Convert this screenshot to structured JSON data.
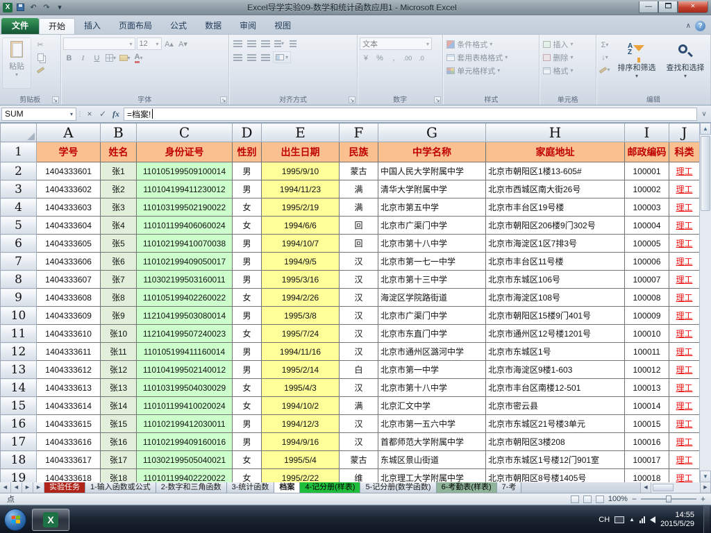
{
  "titlebar": {
    "title": "Excel导学实验09-数学和统计函数应用1 - Microsoft Excel"
  },
  "ribbon": {
    "file_tab": "文件",
    "tabs": [
      "开始",
      "插入",
      "页面布局",
      "公式",
      "数据",
      "审阅",
      "视图"
    ],
    "active_tab": "开始",
    "group_labels": [
      "剪贴板",
      "字体",
      "对齐方式",
      "数字",
      "样式",
      "单元格",
      "编辑"
    ],
    "clipboard": {
      "paste_label": "粘贴"
    },
    "font": {
      "name": "",
      "size": "12"
    },
    "number": {
      "format": "文本"
    },
    "styles_items": [
      "条件格式",
      "套用表格格式",
      "单元格样式"
    ],
    "cells_items": [
      "插入",
      "删除",
      "格式"
    ],
    "editing_items": [
      "排序和筛选",
      "查找和选择"
    ]
  },
  "formula_bar": {
    "name_box": "SUM",
    "formula": "=档案!"
  },
  "sheet": {
    "col_letters": [
      "A",
      "B",
      "C",
      "D",
      "E",
      "F",
      "G",
      "H",
      "I",
      "J"
    ],
    "header_row": [
      "学号",
      "姓名",
      "身份证号",
      "性别",
      "出生日期",
      "民族",
      "中学名称",
      "家庭地址",
      "邮政编码",
      "科类"
    ],
    "rows": [
      [
        "1404333601",
        "张1",
        "110105199509100014",
        "男",
        "1995/9/10",
        "蒙古",
        "中国人民大学附属中学",
        "北京市朝阳区1楼13-605#",
        "100001",
        "理工"
      ],
      [
        "1404333602",
        "张2",
        "110104199411230012",
        "男",
        "1994/11/23",
        "满",
        "清华大学附属中学",
        "北京市西城区南大街26号",
        "100002",
        "理工"
      ],
      [
        "1404333603",
        "张3",
        "110103199502190022",
        "女",
        "1995/2/19",
        "满",
        "北京市第五中学",
        "北京市丰台区19号楼",
        "100003",
        "理工"
      ],
      [
        "1404333604",
        "张4",
        "110101199406060024",
        "女",
        "1994/6/6",
        "回",
        "北京市广渠门中学",
        "北京市朝阳区206楼9门302号",
        "100004",
        "理工"
      ],
      [
        "1404333605",
        "张5",
        "110102199410070038",
        "男",
        "1994/10/7",
        "回",
        "北京市第十八中学",
        "北京市海淀区1区7排3号",
        "100005",
        "理工"
      ],
      [
        "1404333606",
        "张6",
        "110102199409050017",
        "男",
        "1994/9/5",
        "汉",
        "北京市第一七一中学",
        "北京市丰台区11号楼",
        "100006",
        "理工"
      ],
      [
        "1404333607",
        "张7",
        "110302199503160011",
        "男",
        "1995/3/16",
        "汉",
        "北京市第十三中学",
        "北京市东城区106号",
        "100007",
        "理工"
      ],
      [
        "1404333608",
        "张8",
        "110105199402260022",
        "女",
        "1994/2/26",
        "汉",
        "海淀区学院路街道",
        "北京市海淀区108号",
        "100008",
        "理工"
      ],
      [
        "1404333609",
        "张9",
        "112104199503080014",
        "男",
        "1995/3/8",
        "汉",
        "北京市广渠门中学",
        "北京市朝阳区15楼9门401号",
        "100009",
        "理工"
      ],
      [
        "1404333610",
        "张10",
        "112104199507240023",
        "女",
        "1995/7/24",
        "汉",
        "北京市东直门中学",
        "北京市通州区12号楼1201号",
        "100010",
        "理工"
      ],
      [
        "1404333611",
        "张11",
        "110105199411160014",
        "男",
        "1994/11/16",
        "汉",
        "北京市通州区潞河中学",
        "北京市东城区1号",
        "100011",
        "理工"
      ],
      [
        "1404333612",
        "张12",
        "110104199502140012",
        "男",
        "1995/2/14",
        "白",
        "北京市第一中学",
        "北京市海淀区9楼1-603",
        "100012",
        "理工"
      ],
      [
        "1404333613",
        "张13",
        "110103199504030029",
        "女",
        "1995/4/3",
        "汉",
        "北京市第十八中学",
        "北京市丰台区南楼12-501",
        "100013",
        "理工"
      ],
      [
        "1404333614",
        "张14",
        "110101199410020024",
        "女",
        "1994/10/2",
        "满",
        "北京汇文中学",
        "北京市密云县",
        "100014",
        "理工"
      ],
      [
        "1404333615",
        "张15",
        "110102199412030011",
        "男",
        "1994/12/3",
        "汉",
        "北京市第一五六中学",
        "北京市东城区21号楼3单元",
        "100015",
        "理工"
      ],
      [
        "1404333616",
        "张16",
        "110102199409160016",
        "男",
        "1994/9/16",
        "汉",
        "首都师范大学附属中学",
        "北京市朝阳区3楼208",
        "100016",
        "理工"
      ],
      [
        "1404333617",
        "张17",
        "110302199505040021",
        "女",
        "1995/5/4",
        "蒙古",
        "东城区景山街道",
        "北京市东城区1号楼12门901室",
        "100017",
        "理工"
      ],
      [
        "1404333618",
        "张18",
        "110101199402220022",
        "女",
        "1995/2/22",
        "维",
        "北京理工大学附属中学",
        "北京市朝阳区8号楼1405号",
        "100018",
        "理工"
      ]
    ]
  },
  "sheet_tabs": {
    "tabs": [
      {
        "label": "实验任务",
        "bg": "#AF2318",
        "fg": "#FFFFFF"
      },
      {
        "label": "1-输入函数或公式"
      },
      {
        "label": "2-数字和三角函数"
      },
      {
        "label": "3-统计函数"
      },
      {
        "label": "档案",
        "active": true
      },
      {
        "label": "4-记分册(样表)",
        "bg": "#1FBF3C",
        "fg": "#000000"
      },
      {
        "label": "5-记分册(数学函数)"
      },
      {
        "label": "6-考勤表(样表)",
        "bg": "#8FB49A",
        "fg": "#000000"
      },
      {
        "label": "7-考"
      }
    ]
  },
  "status_bar": {
    "mode": "点",
    "zoom": "100%"
  },
  "taskbar": {
    "lang": "CH",
    "time": "14:55",
    "date": "2015/5/29"
  },
  "icons": {
    "undo": "↶",
    "redo": "↷",
    "dropdown": "▼",
    "dropdown_small": "▾",
    "cut": "✂",
    "sum": "Σ",
    "fill_down": "↓",
    "cancel": "×",
    "confirm": "✓",
    "fx": "fx",
    "bold": "B",
    "italic": "I",
    "underline": "U",
    "grow_font": "A▴",
    "shrink_font": "A▾",
    "currency": "¥",
    "percent": "%",
    "comma": ",",
    "inc_decimal": ".00",
    "dec_decimal": ".0",
    "minimize_ribbon": "∧",
    "help": "?",
    "scroll_left": "◀",
    "scroll_right": "▶",
    "up": "▲",
    "down": "▼",
    "minimize": "—",
    "close": "×",
    "grip": "⋮"
  },
  "colors": {
    "header_bg": "#FAC090",
    "header_text": "#C00000",
    "col_b_bg": "#E2EFDA",
    "col_c_bg": "#CCFFCC",
    "col_e_bg": "#FFFF99",
    "kelei_text": "#EE1111"
  }
}
